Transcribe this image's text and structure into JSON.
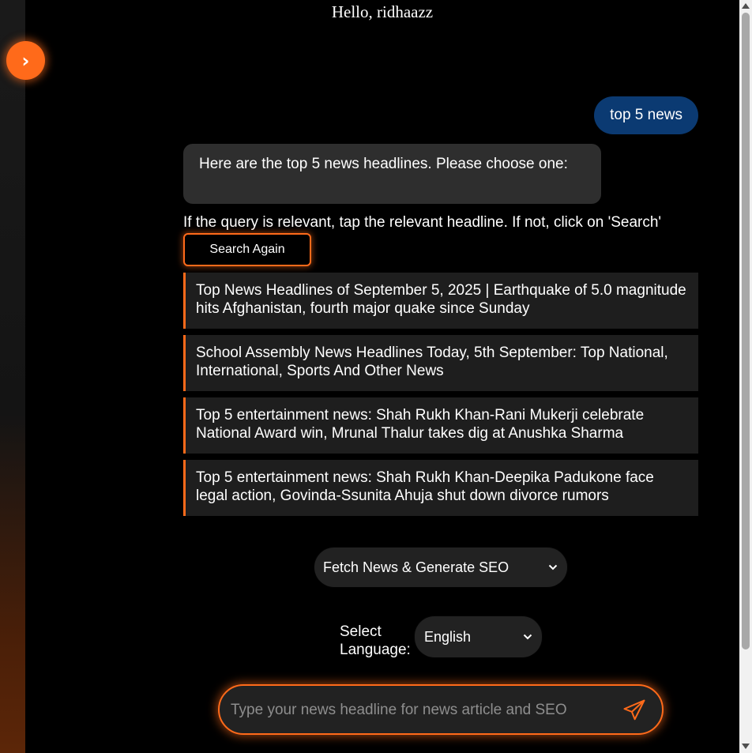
{
  "sidebar": {
    "toggle_icon": "›"
  },
  "header": {
    "greeting": "Hello, ridhaazz"
  },
  "chat": {
    "user_message": "top 5 news",
    "bot_message": "Here are the top 5 news headlines. Please choose one:",
    "hint": "If the query is relevant, tap the relevant headline. If not, click on 'Search'",
    "search_again_label": "Search Again",
    "headlines": [
      "Top News Headlines of September 5, 2025 | Earthquake of 5.0 magnitude hits Afghanistan, fourth major quake since Sunday",
      "School Assembly News Headlines Today, 5th September: Top National, International, Sports And Other News",
      "Top 5 entertainment news: Shah Rukh Khan-Rani Mukerji celebrate National Award win, Mrunal Thalur takes dig at Anushka Sharma",
      "Top 5 entertainment news: Shah Rukh Khan-Deepika Padukone face legal action, Govinda-Ssunita Ahuja shut down divorce rumors"
    ]
  },
  "controls": {
    "mode_select_value": "Fetch News & Generate SEO",
    "language_label": "Select Language:",
    "language_value": "English"
  },
  "input": {
    "placeholder": "Type your news headline for news article and SEO",
    "value": ""
  },
  "colors": {
    "accent": "#ff6a1a",
    "user_bubble": "#0b3a72",
    "bot_bubble": "#2e2e2e",
    "headline_bg": "#1e1e1e"
  }
}
